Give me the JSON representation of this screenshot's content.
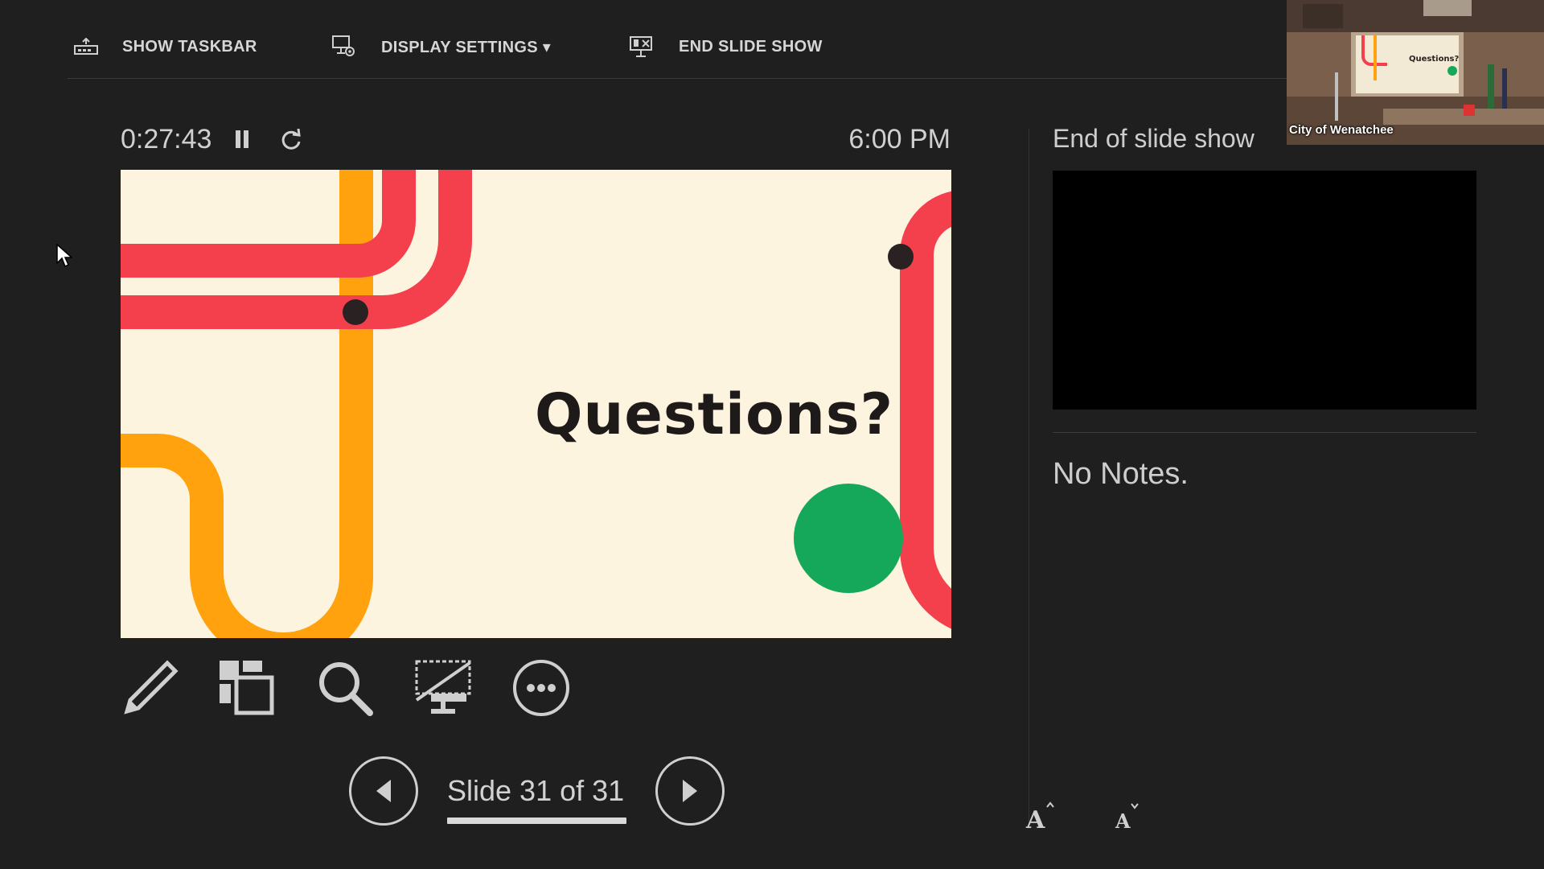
{
  "toolbar": {
    "show_taskbar": "SHOW TASKBAR",
    "display_settings": "DISPLAY SETTINGS ▾",
    "end_slide_show": "END SLIDE SHOW"
  },
  "timer": {
    "elapsed": "0:27:43",
    "clock": "6:00 PM"
  },
  "slide": {
    "title": "Questions?"
  },
  "navigation": {
    "counter": "Slide 31 of 31",
    "progress": 1.0
  },
  "next_slide": {
    "label": "End of slide show"
  },
  "notes": {
    "text": "No Notes."
  },
  "webcam": {
    "label": "City of Wenatchee"
  },
  "colors": {
    "background": "#1f1f1f",
    "slide_bg": "#fdf4df",
    "red_line": "#f4404d",
    "orange_line": "#ffa20d",
    "green_dot": "#15a85a",
    "dot": "#2a2222"
  },
  "icons": [
    "taskbar-icon",
    "display-settings-icon",
    "end-show-icon",
    "pause-icon",
    "restart-icon",
    "pen-icon",
    "see-all-slides-icon",
    "zoom-icon",
    "black-screen-icon",
    "more-options-icon",
    "prev-arrow-icon",
    "next-arrow-icon",
    "font-increase-icon",
    "font-decrease-icon",
    "mouse-cursor-icon"
  ]
}
